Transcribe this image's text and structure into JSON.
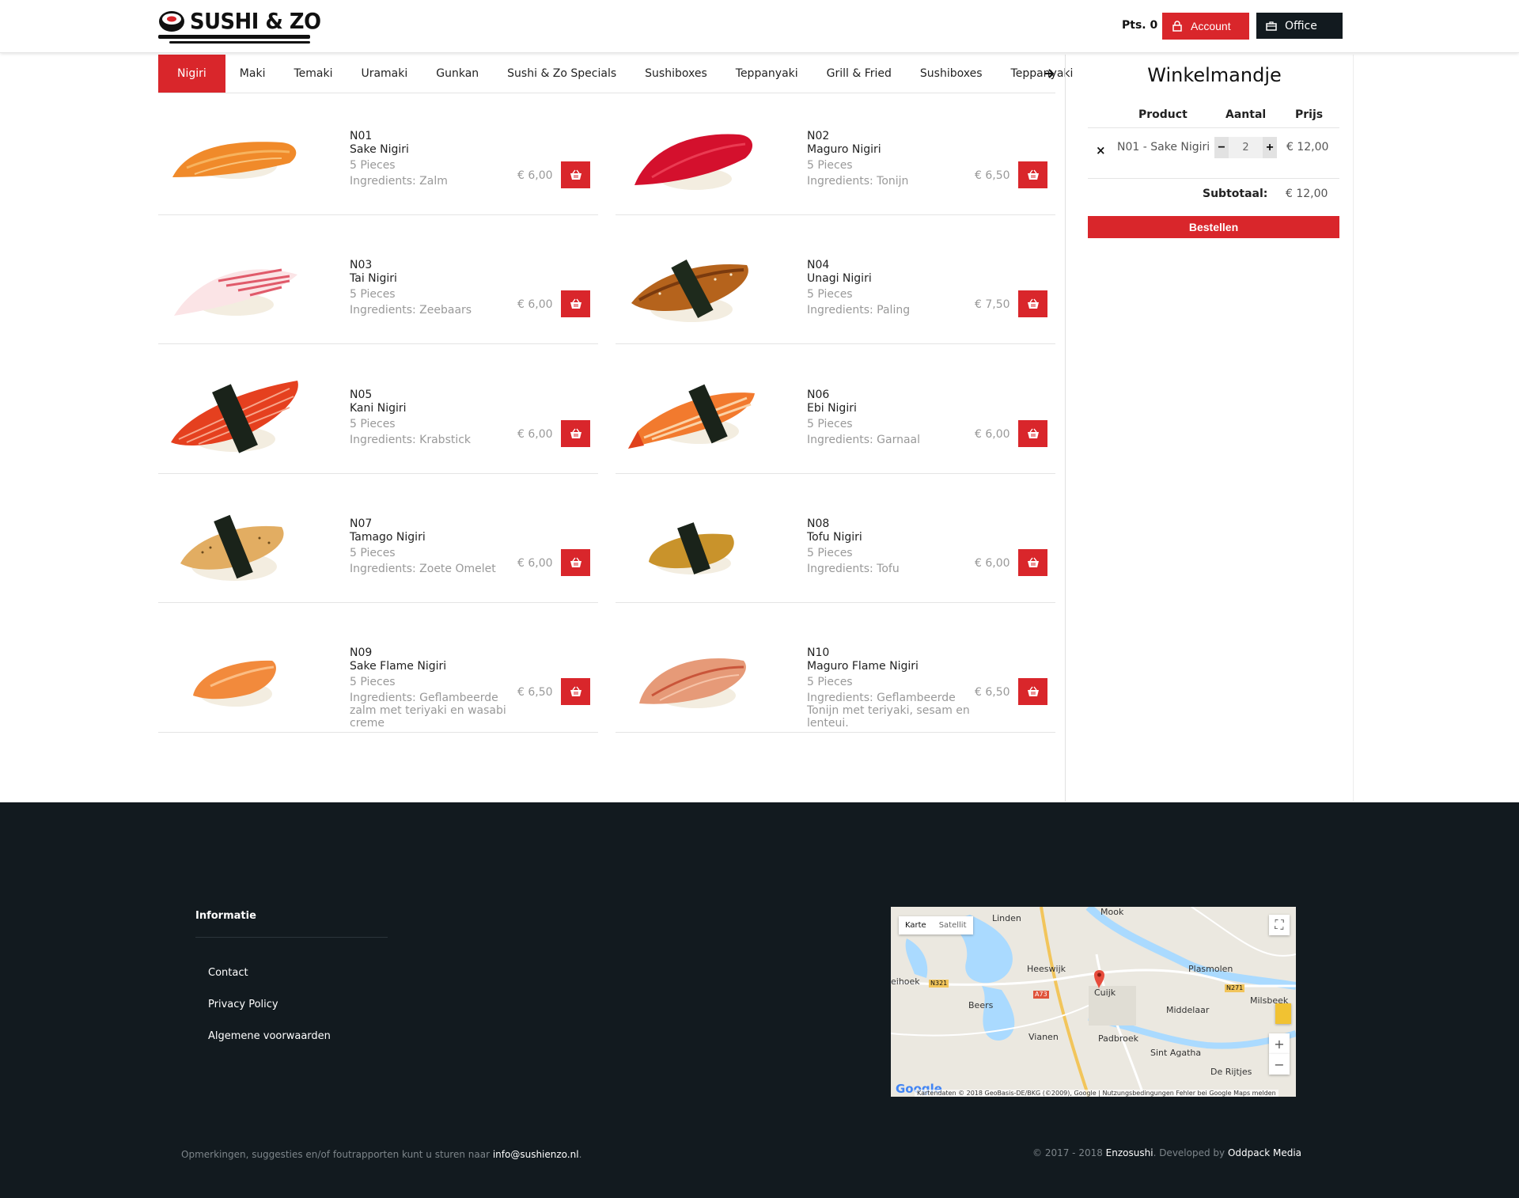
{
  "header": {
    "logo_text": "SUSHI & ZO",
    "points_label": "Pts. 0",
    "account_label": "Account",
    "office_label": "Office"
  },
  "tabs": [
    "Nigiri",
    "Maki",
    "Temaki",
    "Uramaki",
    "Gunkan",
    "Sushi & Zo Specials",
    "Sushiboxes",
    "Teppanyaki",
    "Grill & Fried",
    "Sushiboxes",
    "Teppanyaki"
  ],
  "active_tab": "Nigiri",
  "products": [
    {
      "code": "N01",
      "name": "Sake Nigiri",
      "pieces": "5 Pieces",
      "ingredients": "Ingredients: Zalm",
      "price": "€ 6,00"
    },
    {
      "code": "N02",
      "name": "Maguro Nigiri",
      "pieces": "5 Pieces",
      "ingredients": "Ingredients: Tonijn",
      "price": "€ 6,50"
    },
    {
      "code": "N03",
      "name": "Tai Nigiri",
      "pieces": "5 Pieces",
      "ingredients": "Ingredients: Zeebaars",
      "price": "€ 6,00"
    },
    {
      "code": "N04",
      "name": "Unagi Nigiri",
      "pieces": "5 Pieces",
      "ingredients": "Ingredients: Paling",
      "price": "€ 7,50"
    },
    {
      "code": "N05",
      "name": "Kani Nigiri",
      "pieces": "5 Pieces",
      "ingredients": "Ingredients: Krabstick",
      "price": "€ 6,00"
    },
    {
      "code": "N06",
      "name": "Ebi Nigiri",
      "pieces": "5 Pieces",
      "ingredients": "Ingredients: Garnaal",
      "price": "€ 6,00"
    },
    {
      "code": "N07",
      "name": "Tamago Nigiri",
      "pieces": "5 Pieces",
      "ingredients": "Ingredients: Zoete Omelet",
      "price": "€ 6,00"
    },
    {
      "code": "N08",
      "name": "Tofu Nigiri",
      "pieces": "5 Pieces",
      "ingredients": "Ingredients: Tofu",
      "price": "€ 6,00"
    },
    {
      "code": "N09",
      "name": "Sake Flame Nigiri",
      "pieces": "5 Pieces",
      "ingredients": "Ingredients: Geflambeerde zalm met teriyaki en wasabi creme",
      "price": "€ 6,50"
    },
    {
      "code": "N10",
      "name": "Maguro Flame Nigiri",
      "pieces": "5 Pieces",
      "ingredients": "Ingredients: Geflambeerde Tonijn met teriyaki, sesam en lenteui.",
      "price": "€ 6,50"
    }
  ],
  "cart": {
    "title": "Winkelmandje",
    "col_product": "Product",
    "col_qty": "Aantal",
    "col_price": "Prijs",
    "item_name": "N01 - Sake Nigiri",
    "item_qty": "2",
    "item_price": "€ 12,00",
    "remove_icon": "×",
    "minus": "−",
    "plus": "+",
    "subtotal_label": "Subtotaal:",
    "subtotal_value": "€ 12,00",
    "order_label": "Bestellen"
  },
  "footer": {
    "info_title": "Informatie",
    "links": [
      "Contact",
      "Privacy Policy",
      "Algemene voorwaarden"
    ],
    "note_prefix": "Opmerkingen, suggesties en/of foutrapporten kunt u sturen naar ",
    "note_email": "info@sushienzo.nl",
    "note_suffix": ".",
    "copy_prefix": "© 2017 - 2018 ",
    "copy_brand": "Enzosushi",
    "copy_mid": ". Developed by ",
    "copy_dev": "Oddpack Media"
  },
  "map": {
    "tab_map": "Karte",
    "tab_satellite": "Satellit",
    "places": [
      "Mook",
      "Linden",
      "Heeswijk",
      "Plasmolen",
      "eihoek",
      "Beers",
      "Cuijk",
      "Middelaar",
      "Milsbeek",
      "Vianen",
      "Padbroek",
      "Sint Agatha",
      "De Rijtjes"
    ],
    "roads": [
      "N321",
      "A73",
      "N271"
    ],
    "attribution": "Kartendaten © 2018 GeoBasis-DE/BKG (©2009), Google | Nutzungsbedingungen     Fehler bei Google Maps melden",
    "google": "Google",
    "zoom_in": "+",
    "zoom_out": "−"
  },
  "colors": {
    "accent": "#d9262b",
    "dark": "#121a1f"
  }
}
